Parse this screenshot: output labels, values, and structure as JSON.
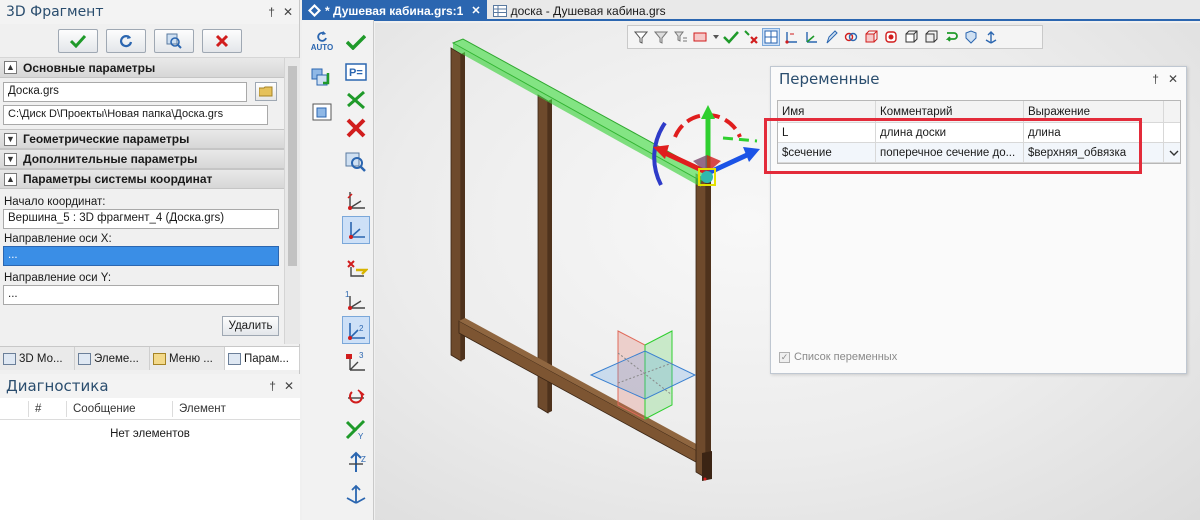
{
  "left_panel": {
    "title": "3D Фрагмент",
    "pin_glyph": "†",
    "close_glyph": "✕",
    "sections": {
      "basic": "Основные параметры",
      "geometric": "Геометрические параметры",
      "additional": "Дополнительные параметры",
      "coord": "Параметры системы координат"
    },
    "file_name": "Доска.grs",
    "file_path": "C:\\Диск D\\Проекты\\Новая папка\\Доска.grs",
    "origin_label": "Начало координат:",
    "origin_value": "Вершина_5 : 3D фрагмент_4 (Доска.grs)",
    "x_axis_label": "Направление оси X:",
    "x_axis_value": "...",
    "y_axis_label": "Направление оси Y:",
    "y_axis_value": "...",
    "delete_label": "Удалить",
    "tabs": [
      "3D Мо...",
      "Элеме...",
      "Меню ...",
      "Парам..."
    ]
  },
  "diagnostics": {
    "title": "Диагностика",
    "col_num": "#",
    "col_message": "Сообщение",
    "col_element": "Элемент",
    "empty_text": "Нет элементов"
  },
  "toolbar": {
    "auto_label": "AUTO"
  },
  "doc_tabs": {
    "active": "* Душевая кабина.grs:1",
    "close_glyph": "✕",
    "inactive": "доска - Душевая кабина.grs"
  },
  "variables": {
    "title": "Переменные",
    "pin_glyph": "†",
    "close_glyph": "✕",
    "headers": [
      "Имя",
      "Комментарий",
      "Выражение"
    ],
    "rows": [
      {
        "name": "L",
        "comment": "длина доски",
        "expr": "длина"
      },
      {
        "name": "$сечение",
        "comment": "поперечное сечение до...",
        "expr": "$верхняя_обвязка"
      }
    ],
    "list_label": "Список переменных"
  },
  "colors": {
    "accent": "#2b66b0",
    "highlight": "#e32b3a",
    "wood": "#6e4a2c",
    "selection_green": "#3fd33f"
  }
}
